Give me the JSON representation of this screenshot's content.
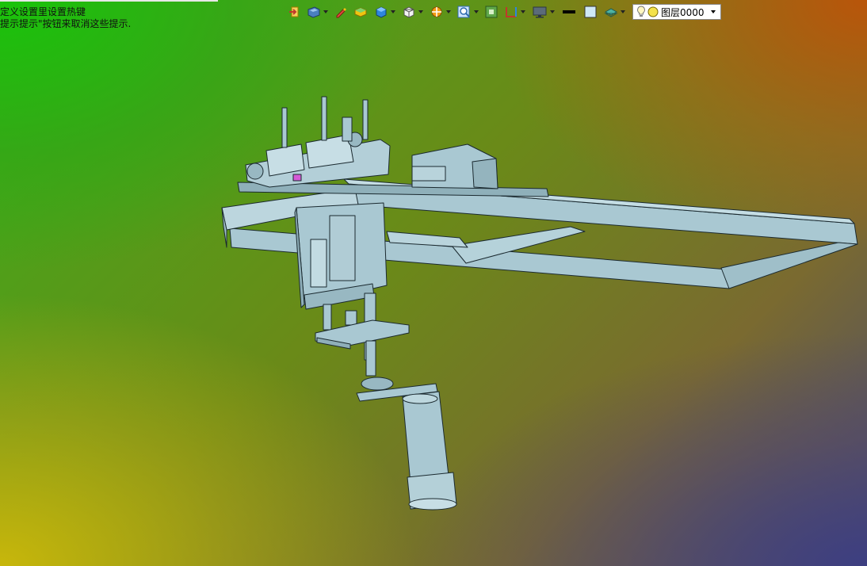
{
  "status": {
    "hint_line1": "定义设置里设置热键",
    "hint_line2": "提示提示\"按钮来取消这些提示."
  },
  "toolbar": {
    "icons": [
      "exit-icon",
      "view-orientation-icon",
      "pen-icon",
      "solid-box-icon",
      "shaded-cube-icon",
      "wire-cube-icon",
      "section-view-icon",
      "zoom-icon",
      "fit-view-icon",
      "frame-icon",
      "display-monitor-icon",
      "line-color-swatch",
      "fill-color-swatch",
      "layer-style-icon"
    ],
    "layer": {
      "visibility_icon": "lightbulb-icon",
      "color_icon": "yellow-dot-icon",
      "label": "图层0000"
    }
  },
  "colors": {
    "model_fill": "#a9c8d2",
    "model_edge": "#1b2a30",
    "accent_pink": "#d65ad6"
  }
}
